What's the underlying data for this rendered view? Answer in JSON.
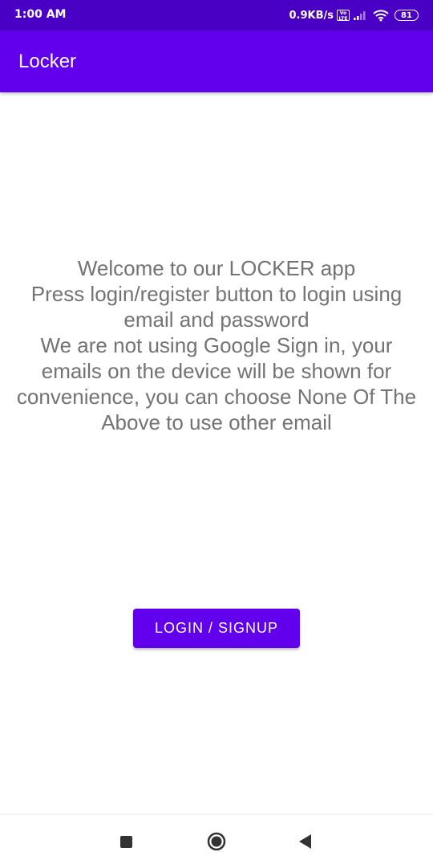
{
  "status_bar": {
    "time": "1:00 AM",
    "network_speed": "0.9KB/s",
    "volte_label": "Vo LTE",
    "battery_level": "81",
    "icons": [
      "volte-icon",
      "signal-icon",
      "wifi-icon",
      "battery-icon"
    ]
  },
  "app_bar": {
    "title": "Locker",
    "color": "#6200ee"
  },
  "main": {
    "welcome_text": "Welcome to our LOCKER app\nPress login/register button to login using email and password\nWe are not using Google Sign in, your emails on the device will be shown for convenience, you can choose None Of The Above to use other email",
    "login_button_label": "LOGIN / SIGNUP"
  },
  "nav_bar": {
    "icons": [
      "recents-icon",
      "home-icon",
      "back-icon"
    ]
  },
  "colors": {
    "status_bar": "#4a00c4",
    "primary": "#6200ee",
    "text_secondary": "#737373"
  }
}
